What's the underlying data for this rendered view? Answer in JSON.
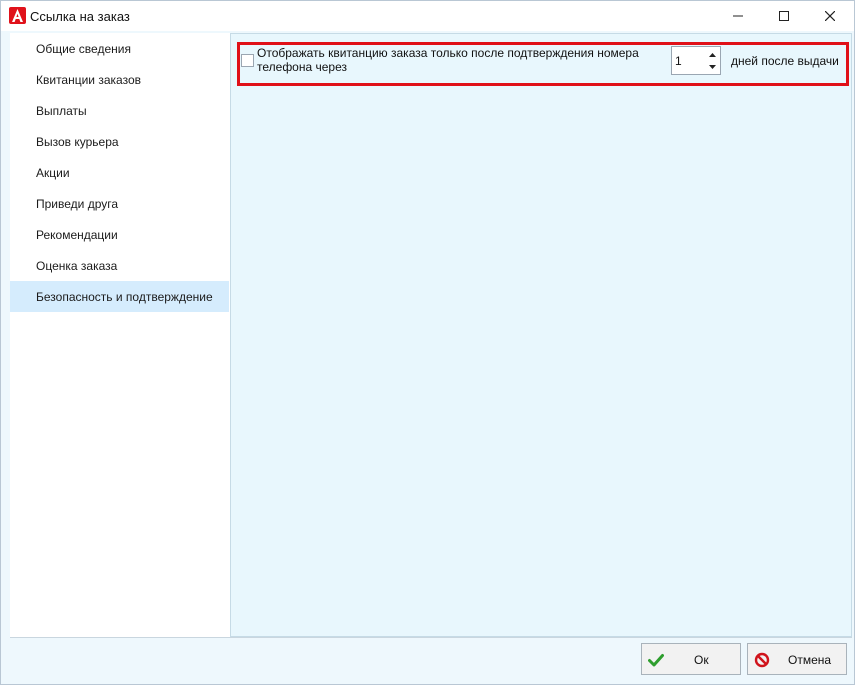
{
  "window": {
    "title": "Ссылка на заказ",
    "logo_letter": "A"
  },
  "sidebar": {
    "selected_index": 8,
    "items": [
      {
        "label": "Общие сведения"
      },
      {
        "label": "Квитанции заказов"
      },
      {
        "label": "Выплаты"
      },
      {
        "label": "Вызов курьера"
      },
      {
        "label": "Акции"
      },
      {
        "label": "Приведи друга"
      },
      {
        "label": "Рекомендации"
      },
      {
        "label": "Оценка заказа"
      },
      {
        "label": "Безопасность и подтверждение"
      }
    ]
  },
  "content": {
    "option_label": "Отображать квитанцию заказа только после подтверждения номера телефона через",
    "option_checked": false,
    "stepper_value": "1",
    "suffix_label": "дней после выдачи"
  },
  "footer": {
    "ok_label": "Ок",
    "cancel_label": "Отмена"
  },
  "colors": {
    "highlight": "#e01018",
    "selected_bg": "#d5ecfd",
    "content_bg": "#e8f7fd",
    "ok_icon": "#2e9e2e",
    "cancel_icon": "#d0141c"
  },
  "icons": {
    "logo": "app-logo-icon",
    "minimize": "minimize-icon",
    "maximize": "maximize-icon",
    "close": "close-icon",
    "ok": "checkmark-icon",
    "cancel": "cancel-circle-icon"
  }
}
